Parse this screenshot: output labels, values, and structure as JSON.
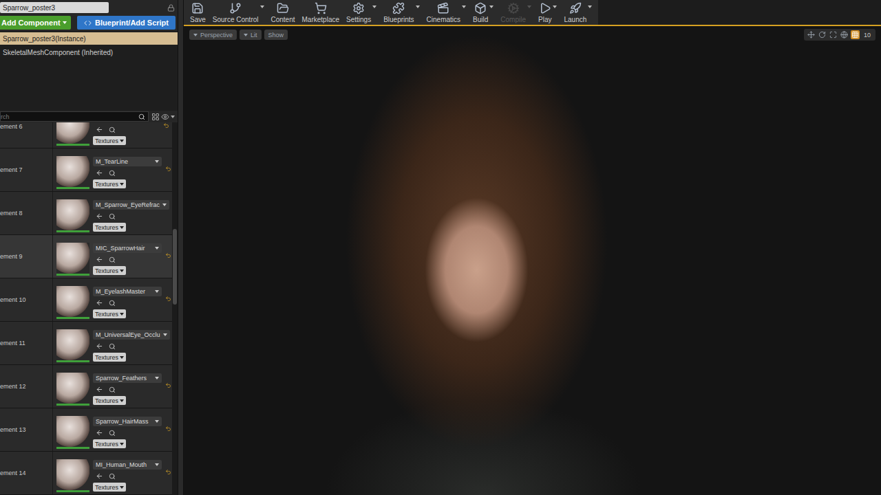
{
  "name_field": {
    "value": "Sparrow_poster3"
  },
  "buttons": {
    "add_component": "Add Component",
    "blueprint": "Blueprint/Add Script"
  },
  "components": [
    {
      "label": "Sparrow_poster3(Instance)",
      "selected": true
    },
    {
      "label": "SkeletalMeshComponent (Inherited)",
      "selected": false
    }
  ],
  "search": {
    "placeholder": "rch"
  },
  "materials": [
    {
      "label": "ement 6",
      "name": "",
      "selected": false,
      "textures": "Textures"
    },
    {
      "label": "ement 7",
      "name": "M_TearLine",
      "selected": false,
      "textures": "Textures"
    },
    {
      "label": "ement 8",
      "name": "M_Sparrow_EyeRefrac",
      "selected": false,
      "textures": "Textures"
    },
    {
      "label": "ement 9",
      "name": "MIC_SparrowHair",
      "selected": true,
      "textures": "Textures"
    },
    {
      "label": "ement 10",
      "name": "M_EyelashMaster",
      "selected": false,
      "textures": "Textures"
    },
    {
      "label": "ement 11",
      "name": "M_UniversalEye_Occlu",
      "selected": false,
      "textures": "Textures"
    },
    {
      "label": "ement 12",
      "name": "Sparrow_Feathers",
      "selected": false,
      "textures": "Textures"
    },
    {
      "label": "ement 13",
      "name": "Sparrow_HairMass",
      "selected": false,
      "textures": "Textures"
    },
    {
      "label": "ement 14",
      "name": "MI_Human_Mouth",
      "selected": false,
      "textures": "Textures"
    }
  ],
  "toolbar": [
    {
      "label": "Save",
      "disabled": false,
      "dropdown": false
    },
    {
      "label": "Source Control",
      "disabled": false,
      "dropdown": true
    },
    {
      "label": "Content",
      "disabled": false,
      "dropdown": false
    },
    {
      "label": "Marketplace",
      "disabled": false,
      "dropdown": false
    },
    {
      "label": "Settings",
      "disabled": false,
      "dropdown": true
    },
    {
      "label": "Blueprints",
      "disabled": false,
      "dropdown": true
    },
    {
      "label": "Cinematics",
      "disabled": false,
      "dropdown": true
    },
    {
      "label": "Build",
      "disabled": false,
      "dropdown": true
    },
    {
      "label": "Compile",
      "disabled": true,
      "dropdown": true
    },
    {
      "label": "Play",
      "disabled": false,
      "dropdown": true
    },
    {
      "label": "Launch",
      "disabled": false,
      "dropdown": true
    }
  ],
  "viewport": {
    "buttons": [
      "Perspective",
      "Lit",
      "Show"
    ],
    "grid_size": "10"
  }
}
